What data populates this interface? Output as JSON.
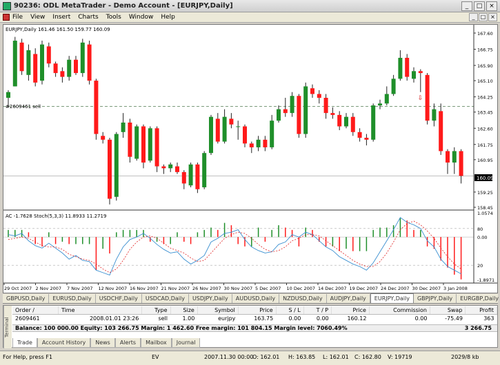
{
  "window": {
    "title": "90236: ODL MetaTrader - Demo Account - [EURJPY,Daily]",
    "min": "_",
    "max": "□",
    "close": "×"
  },
  "menu": [
    "File",
    "View",
    "Insert",
    "Charts",
    "Tools",
    "Window",
    "Help"
  ],
  "chart": {
    "header": "EURJPY,Daily  161.46 161.50 159.77 160.09",
    "order_line_label": "#2609461 sell",
    "indicator_header": "AC -1.7628  Stoch(5,3,3) 11.8933 11.2719",
    "price_ticks": [
      "167.60",
      "166.75",
      "165.90",
      "165.10",
      "164.25",
      "163.45",
      "162.60",
      "161.75",
      "160.95",
      "160.09",
      "159.25",
      "158.45"
    ],
    "current_price": "160.09",
    "ind_ticks": [
      "1.0574",
      "80",
      "0.00",
      "20",
      "-1.8971"
    ],
    "date_ticks": [
      "29 Oct 2007",
      "2 Nov 2007",
      "7 Nov 2007",
      "12 Nov 2007",
      "16 Nov 2007",
      "21 Nov 2007",
      "26 Nov 2007",
      "30 Nov 2007",
      "5 Dec 2007",
      "10 Dec 2007",
      "14 Dec 2007",
      "19 Dec 2007",
      "24 Dec 2007",
      "30 Dec 2007",
      "3 Jan 2008"
    ],
    "colors": {
      "bull": "#1f8f2a",
      "bear": "#ff1a1a",
      "grid": "#7a9a7a"
    }
  },
  "symbol_tabs": [
    "GBPUSD,Daily",
    "EURUSD,Daily",
    "USDCHF,Daily",
    "USDCAD,Daily",
    "USDJPY,Daily",
    "AUDUSD,Daily",
    "NZDUSD,Daily",
    "AUDJPY,Daily",
    "EURJPY,Daily",
    "GBPJPY,Daily",
    "EURGBP,Daily"
  ],
  "active_symbol_tab": "EURJPY,Daily",
  "terminal": {
    "side_label": "Terminal",
    "headers": [
      "Order /",
      "Time",
      "Type",
      "Size",
      "Symbol",
      "Price",
      "S / L",
      "T / P",
      "Price",
      "Commission",
      "Swap",
      "Profit"
    ],
    "row": [
      "2609461",
      "2008.01.01 23:26",
      "sell",
      "1.00",
      "eurjpy",
      "163.75",
      "0.00",
      "0.00",
      "160.12",
      "0.00",
      "-75.49",
      "363"
    ],
    "balance": "Balance: 100 000.00  Equity: 103 266.75  Margin: 1 462.60  Free margin: 101 804.15  Margin level: 7060.49%",
    "balance_profit": "3 266.75",
    "tabs": [
      "Trade",
      "Account History",
      "News",
      "Alerts",
      "Mailbox",
      "Journal"
    ],
    "active_tab": "Trade"
  },
  "status": {
    "help": "For Help, press F1",
    "profile": "EV",
    "datetime": "2007.11.30 00:00",
    "open": "O: 162.01",
    "high": "H: 163.85",
    "low": "L: 162.01",
    "close": "C: 162.80",
    "volume": "V: 19719",
    "traffic": "2029/8 kb"
  },
  "candles": [
    [
      164.2,
      164.5,
      163.7,
      164.6
    ],
    [
      164.8,
      167.2,
      164.8,
      167.4
    ],
    [
      167.1,
      165.6,
      165.4,
      167.3
    ],
    [
      165.4,
      166.7,
      165.1,
      167.0
    ],
    [
      166.5,
      165.0,
      164.8,
      166.8
    ],
    [
      165.1,
      167.0,
      164.9,
      167.2
    ],
    [
      166.9,
      166.0,
      165.8,
      167.1
    ],
    [
      166.0,
      165.5,
      165.3,
      166.1
    ],
    [
      165.6,
      165.3,
      165.0,
      165.8
    ],
    [
      165.3,
      166.2,
      165.1,
      166.4
    ],
    [
      166.2,
      165.5,
      165.4,
      166.4
    ],
    [
      165.5,
      167.1,
      165.3,
      167.3
    ],
    [
      167.0,
      165.1,
      164.9,
      167.2
    ],
    [
      165.1,
      162.3,
      162.0,
      165.2
    ],
    [
      162.2,
      162.0,
      161.8,
      162.4
    ],
    [
      162.0,
      158.9,
      158.6,
      162.1
    ],
    [
      159.0,
      162.3,
      158.8,
      162.4
    ],
    [
      162.4,
      162.9,
      162.1,
      163.4
    ],
    [
      162.9,
      161.1,
      160.8,
      163.1
    ],
    [
      161.0,
      162.7,
      160.9,
      162.8
    ],
    [
      162.7,
      160.8,
      160.5,
      162.8
    ],
    [
      160.9,
      162.6,
      160.8,
      162.7
    ],
    [
      162.6,
      160.6,
      160.3,
      162.7
    ],
    [
      160.6,
      160.5,
      160.2,
      160.7
    ],
    [
      160.5,
      160.7,
      160.3,
      160.8
    ],
    [
      160.6,
      160.3,
      160.2,
      160.8
    ],
    [
      160.3,
      159.7,
      159.4,
      160.4
    ],
    [
      159.6,
      160.7,
      159.5,
      160.8
    ],
    [
      160.7,
      159.4,
      159.2,
      160.8
    ],
    [
      159.5,
      161.3,
      159.4,
      161.4
    ],
    [
      161.3,
      163.2,
      161.2,
      163.3
    ],
    [
      163.1,
      161.9,
      161.8,
      163.4
    ],
    [
      161.9,
      163.2,
      161.8,
      163.6
    ],
    [
      163.1,
      162.8,
      162.6,
      163.4
    ],
    [
      162.7,
      162.7,
      162.0,
      163.0
    ],
    [
      162.7,
      161.8,
      161.6,
      162.8
    ],
    [
      161.8,
      161.6,
      161.3,
      161.9
    ],
    [
      161.6,
      162.0,
      161.4,
      162.2
    ],
    [
      162.0,
      161.6,
      161.4,
      162.2
    ],
    [
      161.6,
      163.0,
      161.5,
      163.3
    ],
    [
      163.0,
      163.6,
      162.9,
      163.8
    ],
    [
      163.6,
      163.4,
      163.2,
      164.2
    ],
    [
      163.4,
      164.3,
      163.2,
      164.5
    ],
    [
      164.3,
      162.3,
      162.1,
      164.4
    ],
    [
      162.3,
      164.8,
      162.1,
      165.0
    ],
    [
      164.7,
      164.4,
      164.2,
      164.9
    ],
    [
      164.4,
      164.2,
      163.9,
      164.6
    ],
    [
      164.2,
      163.4,
      163.1,
      164.4
    ],
    [
      163.4,
      163.3,
      163.1,
      163.7
    ],
    [
      163.3,
      162.7,
      162.5,
      163.5
    ],
    [
      162.7,
      163.2,
      162.6,
      163.4
    ],
    [
      163.2,
      162.4,
      162.2,
      163.4
    ],
    [
      162.4,
      162.1,
      161.9,
      162.6
    ],
    [
      162.1,
      162.0,
      161.7,
      162.3
    ],
    [
      162.0,
      163.8,
      161.9,
      163.9
    ],
    [
      163.8,
      163.9,
      163.6,
      164.1
    ],
    [
      163.9,
      164.4,
      163.8,
      164.8
    ],
    [
      164.4,
      165.2,
      164.3,
      165.4
    ],
    [
      165.2,
      166.3,
      165.1,
      166.7
    ],
    [
      166.3,
      165.3,
      165.1,
      166.5
    ],
    [
      165.2,
      165.6,
      165.0,
      165.8
    ],
    [
      165.6,
      165.5,
      164.5,
      165.7
    ],
    [
      165.4,
      163.0,
      162.8,
      165.5
    ],
    [
      163.0,
      163.6,
      162.7,
      163.9
    ],
    [
      163.5,
      161.4,
      161.2,
      163.9
    ],
    [
      161.4,
      160.8,
      160.2,
      161.5
    ],
    [
      160.8,
      161.4,
      160.2,
      161.6
    ],
    [
      161.4,
      160.1,
      159.7,
      161.5
    ]
  ],
  "ac": [
    0.3,
    0.3,
    0.3,
    0.2,
    -0.3,
    -0.4,
    0.2,
    -0.3,
    -0.2,
    -0.3,
    -0.3,
    -0.3,
    -0.3,
    -1.4,
    -0.5,
    -0.7,
    0.2,
    0.3,
    0.3,
    0.3,
    0.3,
    -0.2,
    -0.2,
    -0.3,
    -0.3,
    0.2,
    -0.2,
    -0.3,
    0.2,
    0.3,
    0.4,
    0.3,
    0.6,
    0.5,
    -0.3,
    -0.4,
    -0.4,
    0.4,
    -0.2,
    0.3,
    0.5,
    0.4,
    0.3,
    -0.4,
    0.4,
    0.3,
    -0.2,
    -0.4,
    -0.4,
    -0.6,
    -0.5,
    -0.6,
    -0.6,
    -0.6,
    0.3,
    0.4,
    0.4,
    0.5,
    0.8,
    0.7,
    0.3,
    0.3,
    -0.4,
    -0.5,
    -1.0,
    -1.3,
    -1.6,
    -1.8
  ],
  "stoch_k": [
    70,
    68,
    72,
    60,
    52,
    48,
    56,
    48,
    40,
    30,
    36,
    28,
    26,
    12,
    8,
    4,
    30,
    50,
    62,
    66,
    72,
    64,
    54,
    46,
    40,
    42,
    30,
    22,
    28,
    36,
    58,
    64,
    72,
    74,
    78,
    62,
    50,
    44,
    40,
    42,
    54,
    58,
    70,
    66,
    74,
    70,
    60,
    50,
    44,
    34,
    28,
    22,
    18,
    12,
    24,
    42,
    60,
    78,
    98,
    90,
    86,
    80,
    60,
    50,
    30,
    18,
    12,
    6
  ],
  "stoch_d": [
    62,
    64,
    66,
    64,
    58,
    52,
    50,
    50,
    46,
    38,
    34,
    30,
    28,
    22,
    14,
    8,
    14,
    28,
    46,
    58,
    66,
    68,
    64,
    56,
    48,
    44,
    40,
    32,
    26,
    28,
    40,
    52,
    64,
    70,
    74,
    72,
    64,
    54,
    46,
    42,
    44,
    50,
    60,
    64,
    70,
    70,
    68,
    60,
    52,
    44,
    36,
    28,
    22,
    18,
    18,
    26,
    40,
    58,
    78,
    88,
    92,
    86,
    76,
    64,
    48,
    34,
    22,
    14
  ]
}
